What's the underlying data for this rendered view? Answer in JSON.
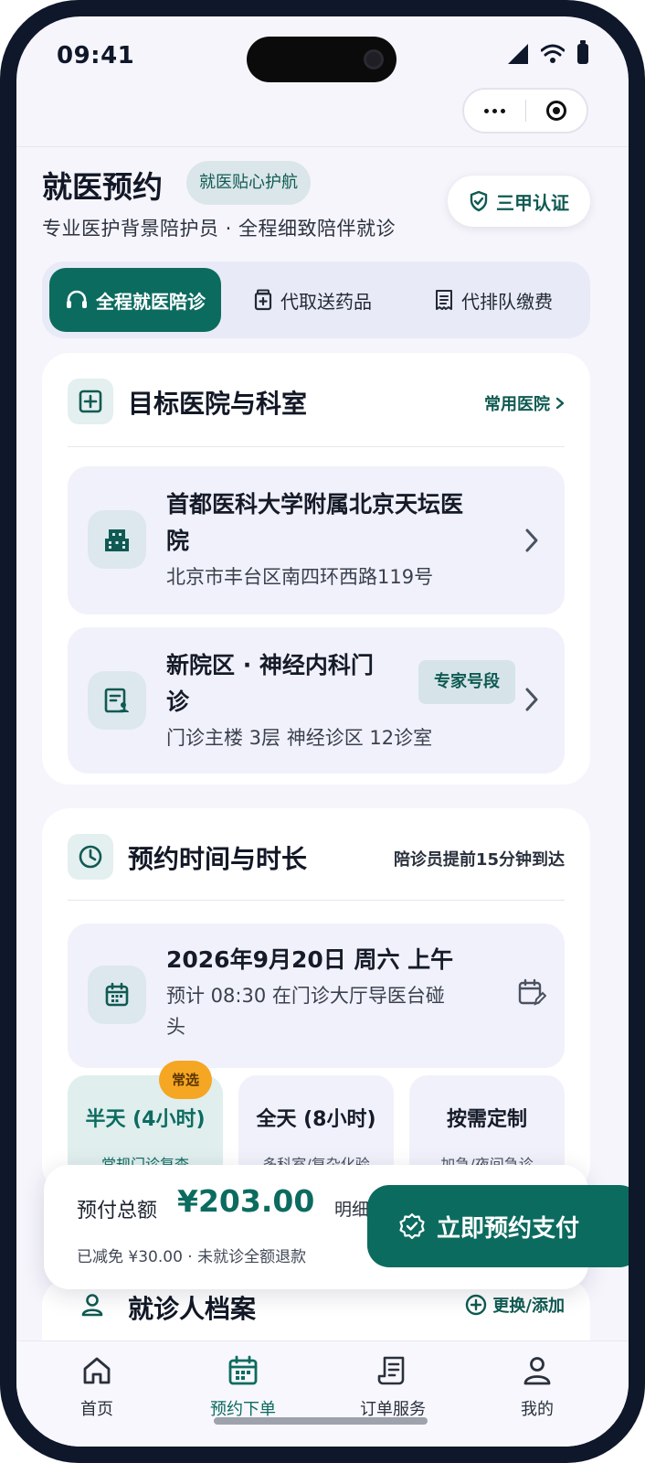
{
  "status": {
    "time": "09:41"
  },
  "header": {
    "title": "就医预约",
    "tag": "就医贴心护航",
    "cert_badge": "三甲认证",
    "subtitle": "专业医护背景陪护员 · 全程细致陪伴就诊"
  },
  "tabs": [
    {
      "label": "全程就医陪诊",
      "icon": "headset-icon",
      "active": true
    },
    {
      "label": "代取送药品",
      "icon": "medicine-box-icon",
      "active": false
    },
    {
      "label": "代排队缴费",
      "icon": "receipt-icon",
      "active": false
    }
  ],
  "hospital_section": {
    "title": "目标医院与科室",
    "link": "常用医院",
    "hospital": {
      "name_line1": "首都医科大学附属北京天坛医",
      "name_line2": "院",
      "address": "北京市丰台区南四环西路119号"
    },
    "department": {
      "name_line1": "新院区 · 神经内科门",
      "name_line2": "诊",
      "tag": "专家号段",
      "location": "门诊主楼 3层 神经诊区 12诊室"
    }
  },
  "time_section": {
    "title": "预约时间与时长",
    "note": "陪诊员提前15分钟到达",
    "date": "2026年9月20日 周六 上午",
    "meet_line1": "预计 08:30 在门诊大厅导医台碰",
    "meet_line2": "头",
    "durations": [
      {
        "title": "半天 (4小时)",
        "sub": "常规门诊复查",
        "badge": "常选",
        "selected": true
      },
      {
        "title": "全天 (8小时)",
        "sub": "多科室/复杂化验",
        "selected": false
      },
      {
        "title": "按需定制",
        "sub": "加急/夜间急诊",
        "selected": false
      }
    ]
  },
  "patient_section": {
    "title": "就诊人档案",
    "link": "更换/添加"
  },
  "paybar": {
    "label": "预付总额",
    "amount": "¥203.00",
    "detail": "明细",
    "note": "已减免 ¥30.00 · 未就诊全额退款",
    "button": "立即预约支付"
  },
  "nav": [
    {
      "label": "首页",
      "icon": "home-icon",
      "active": false
    },
    {
      "label": "预约下单",
      "icon": "calendar-icon",
      "active": true
    },
    {
      "label": "订单服务",
      "icon": "order-icon",
      "active": false
    },
    {
      "label": "我的",
      "icon": "user-icon",
      "active": false
    }
  ],
  "colors": {
    "primary": "#0c6b5f",
    "accent_badge": "#f5a623",
    "background": "#f6f5fc"
  }
}
